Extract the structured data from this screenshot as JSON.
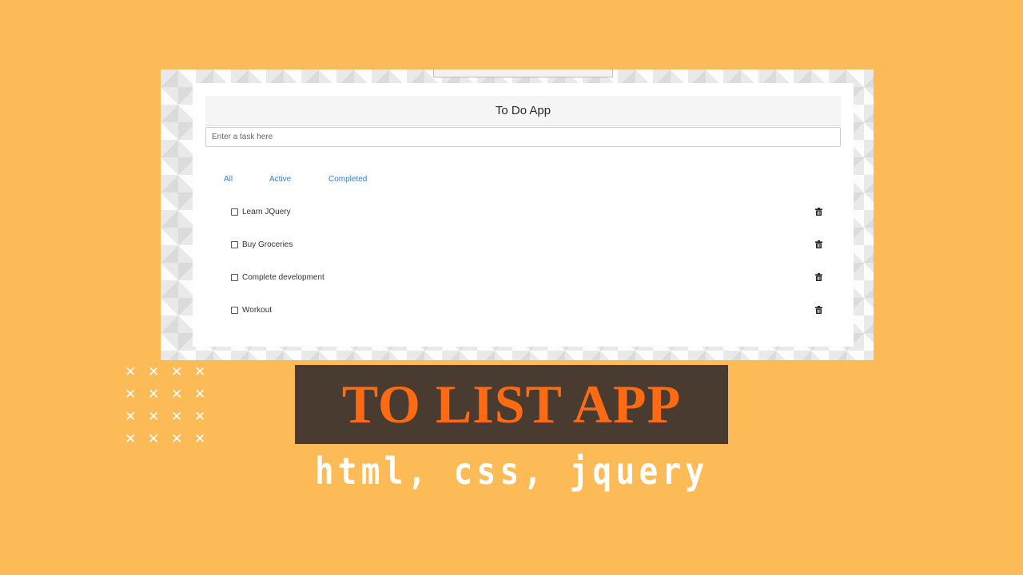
{
  "app": {
    "title": "To Do App",
    "input": {
      "placeholder": "Enter a task here",
      "value": ""
    },
    "filters": [
      {
        "label": "All"
      },
      {
        "label": "Active"
      },
      {
        "label": "Completed"
      }
    ],
    "tasks": [
      {
        "text": "Learn JQuery",
        "checked": false,
        "icon": "trash-icon"
      },
      {
        "text": "Buy Groceries",
        "checked": false,
        "icon": "trash-icon"
      },
      {
        "text": "Complete development",
        "checked": false,
        "icon": "trash-icon"
      },
      {
        "text": "Workout",
        "checked": false,
        "icon": "trash-icon"
      }
    ]
  },
  "banner": {
    "title": "TO LIST APP",
    "subtitle": "html, css, jquery"
  },
  "decoration": {
    "glyph": "✕",
    "count": 16
  },
  "colors": {
    "background": "#FDBB57",
    "banner_bg": "#4A3B30",
    "banner_text": "#FF6A13",
    "link": "#2f7fd1"
  }
}
